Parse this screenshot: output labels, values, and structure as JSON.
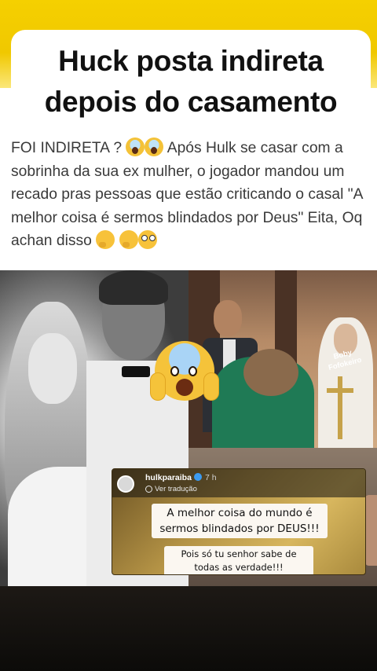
{
  "header": {
    "title_line1": "Huck posta indireta",
    "title_line2": "depois do casamento"
  },
  "post": {
    "text_1": "FOI INDIRETA ? ",
    "text_2": " Após Hulk se casar com a sobrinha da sua ex mulher, o jogador mandou um recado pras pessoas que estão criticando o casal \"A melhor coisa é sermos blindados por Deus\" Eita, Oq achan disso "
  },
  "photos": {
    "watermark": "Boby Fofokeiro"
  },
  "story": {
    "username": "hulkparaiba",
    "time": "7 h",
    "translate": "Ver tradução",
    "message_1": "A melhor coisa do mundo é sermos blindados por DEUS!!!",
    "message_2": "Pois só tu senhor sabe de todas as verdade!!!"
  },
  "colors": {
    "accent_yellow": "#f5d000",
    "title_text": "#111111",
    "body_text": "#3a3a3a"
  }
}
